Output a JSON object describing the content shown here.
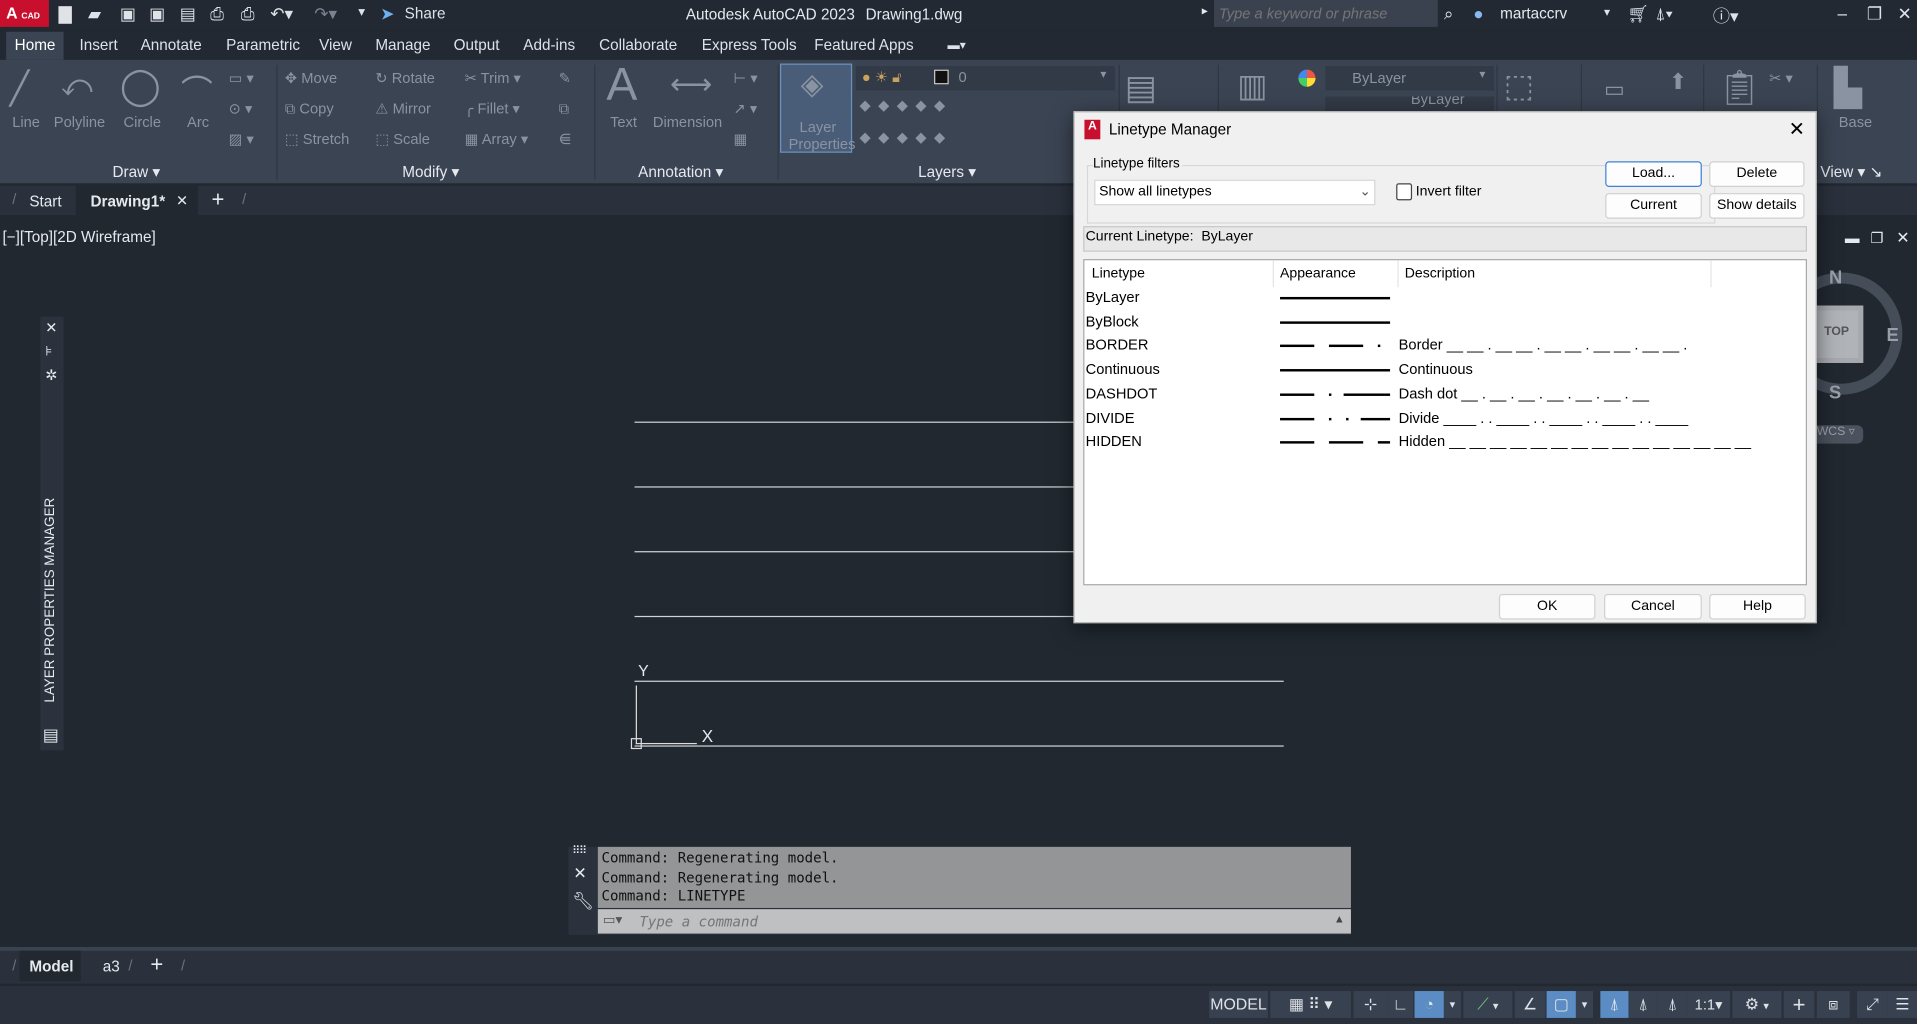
{
  "titlebar": {
    "app_title": "Autodesk AutoCAD 2023",
    "file_name": "Drawing1.dwg",
    "logo_text": "CAD",
    "share_label": "Share",
    "search_placeholder": "Type a keyword or phrase",
    "user": "martaccrv"
  },
  "ribbon_tabs": [
    "Home",
    "Insert",
    "Annotate",
    "Parametric",
    "View",
    "Manage",
    "Output",
    "Add-ins",
    "Collaborate",
    "Express Tools",
    "Featured Apps"
  ],
  "ribbon": {
    "draw": {
      "title": "Draw",
      "tools": [
        "Line",
        "Polyline",
        "Circle",
        "Arc"
      ]
    },
    "modify": {
      "title": "Modify",
      "tools": [
        "Move",
        "Rotate",
        "Trim",
        "Copy",
        "Mirror",
        "Fillet",
        "Stretch",
        "Scale",
        "Array"
      ]
    },
    "annotation": {
      "title": "Annotation",
      "tools": [
        "Text",
        "Dimension"
      ]
    },
    "layers": {
      "title": "Layers",
      "tool": "Layer Properties",
      "current_layer": "0"
    },
    "properties": {
      "bylayer": "ByLayer",
      "bylayer2": "ByLayer"
    },
    "view": {
      "title": "View",
      "base": "Base"
    }
  },
  "file_tabs": {
    "start": "Start",
    "drawing": "Drawing1*"
  },
  "viewport": {
    "label": "[−][Top][2D Wireframe]",
    "side_palette": "LAYER PROPERTIES MANAGER",
    "ucs_x": "X",
    "ucs_y": "Y",
    "viewcube": {
      "n": "N",
      "e": "E",
      "s": "S",
      "top": "TOP",
      "wcs": "WCS"
    }
  },
  "dialog": {
    "title": "Linetype Manager",
    "filters_label": "Linetype filters",
    "filter_value": "Show all linetypes",
    "invert_filter": "Invert filter",
    "invert_checked": false,
    "buttons": {
      "load": "Load...",
      "delete": "Delete",
      "current": "Current",
      "show_details": "Show details",
      "ok": "OK",
      "cancel": "Cancel",
      "help": "Help"
    },
    "current_linetype_label": "Current Linetype:",
    "current_linetype": "ByLayer",
    "columns": [
      "Linetype",
      "Appearance",
      "Description"
    ],
    "rows": [
      {
        "name": "ByLayer",
        "pattern": "solid",
        "description": ""
      },
      {
        "name": "ByBlock",
        "pattern": "solid",
        "description": ""
      },
      {
        "name": "BORDER",
        "pattern": "border",
        "description": "Border __ __ . __ __ . __ __ . __ __ . __ __ ."
      },
      {
        "name": "Continuous",
        "pattern": "solid",
        "description": "Continuous"
      },
      {
        "name": "DASHDOT",
        "pattern": "dashdot",
        "description": "Dash dot __ . __ . __ . __ . __ . __ . __"
      },
      {
        "name": "DIVIDE",
        "pattern": "divide",
        "description": "Divide ____ . . ____ . . ____ . . ____ . . ____"
      },
      {
        "name": "HIDDEN",
        "pattern": "hidden",
        "description": "Hidden __ __ __ __ __ __ __ __ __ __ __ __ __ __ __"
      }
    ]
  },
  "command_line": {
    "history": [
      "Command:  Regenerating model.",
      "Command:  Regenerating model.",
      "Command: LINETYPE"
    ],
    "placeholder": "Type a command"
  },
  "layout_tabs": [
    "Model",
    "a3"
  ],
  "status_bar": {
    "model": "MODEL",
    "scale": "1:1"
  }
}
